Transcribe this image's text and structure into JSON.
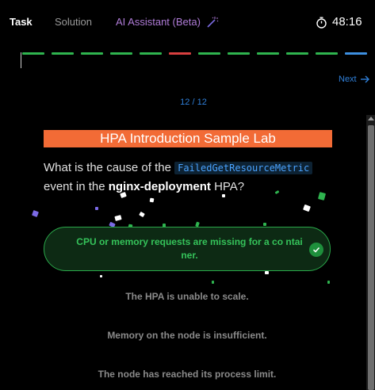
{
  "tabs": {
    "task": "Task",
    "solution": "Solution",
    "ai_assistant": "AI Assistant (Beta)"
  },
  "icons": {
    "wand": "magic-wand-icon",
    "timer": "stopwatch-icon",
    "next": "arrow-right-icon",
    "check": "check-icon"
  },
  "timer": "48:16",
  "progress": {
    "current": 12,
    "total": 12,
    "segment_colors": [
      "#2fb44f",
      "#2fb44f",
      "#2fb44f",
      "#2fb44f",
      "#2fb44f",
      "#d94040",
      "#2fb44f",
      "#2fb44f",
      "#2fb44f",
      "#2fb44f",
      "#2fb44f",
      "#3d8fe0"
    ]
  },
  "navigation": {
    "next_label": "Next",
    "counter": "12 / 12"
  },
  "lab": {
    "title": "HPA Introduction Sample Lab",
    "title_color": "#f26b36"
  },
  "question": {
    "prefix": "What is the cause of the ",
    "code": "FailedGetResourceMetric",
    "middle": " event in the ",
    "bold": "nginx-deployment",
    "suffix": " HPA?"
  },
  "answers": [
    {
      "text": "CPU or memory requests are missing for a co ntainer.",
      "state": "correct"
    },
    {
      "text": "The HPA is unable to scale.",
      "state": "neutral"
    },
    {
      "text": "Memory on the node is insufficient.",
      "state": "neutral"
    },
    {
      "text": "The node has reached its process limit.",
      "state": "neutral"
    }
  ],
  "colors": {
    "accent_blue": "#2f7fd8",
    "correct_green": "#35c35a",
    "ai_purple": "#b07cd8"
  }
}
